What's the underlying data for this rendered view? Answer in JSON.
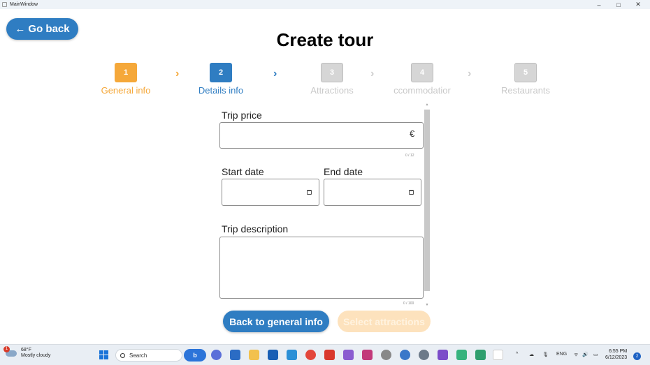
{
  "window": {
    "title": "MainWindow",
    "controls": [
      "–",
      "□",
      "✕"
    ]
  },
  "header": {
    "go_back": "Go back",
    "go_back_arrow": "←",
    "title": "Create tour"
  },
  "stepper": {
    "steps": [
      {
        "number": "1",
        "label": "General info",
        "state": "completed"
      },
      {
        "number": "2",
        "label": "Details info",
        "state": "active"
      },
      {
        "number": "3",
        "label": "Attractions",
        "state": "pending"
      },
      {
        "number": "4",
        "label": "ccommodatior",
        "state": "pending"
      },
      {
        "number": "5",
        "label": "Restaurants",
        "state": "pending"
      }
    ],
    "colors": {
      "completed": "#f5a83a",
      "active": "#2f7dc2",
      "pending": "#d6d6d6"
    }
  },
  "form": {
    "trip_price": {
      "label": "Trip price",
      "value": "",
      "currency": "€",
      "counter": "0 / 12"
    },
    "start_date": {
      "label": "Start date",
      "value": ""
    },
    "end_date": {
      "label": "End date",
      "value": ""
    },
    "trip_description": {
      "label": "Trip description",
      "value": "",
      "counter": "0 / 100"
    }
  },
  "actions": {
    "back": "Back to general info",
    "next": "Select attractions"
  },
  "taskbar": {
    "weather": {
      "badge": "1",
      "temp": "68°F",
      "condition": "Mostly cloudy"
    },
    "search_placeholder": "Search",
    "bing": "b",
    "tray": {
      "lang": "ENG",
      "chevron": "^"
    },
    "clock": {
      "time": "6:55 PM",
      "date": "6/12/2023"
    },
    "notifications": "2"
  }
}
